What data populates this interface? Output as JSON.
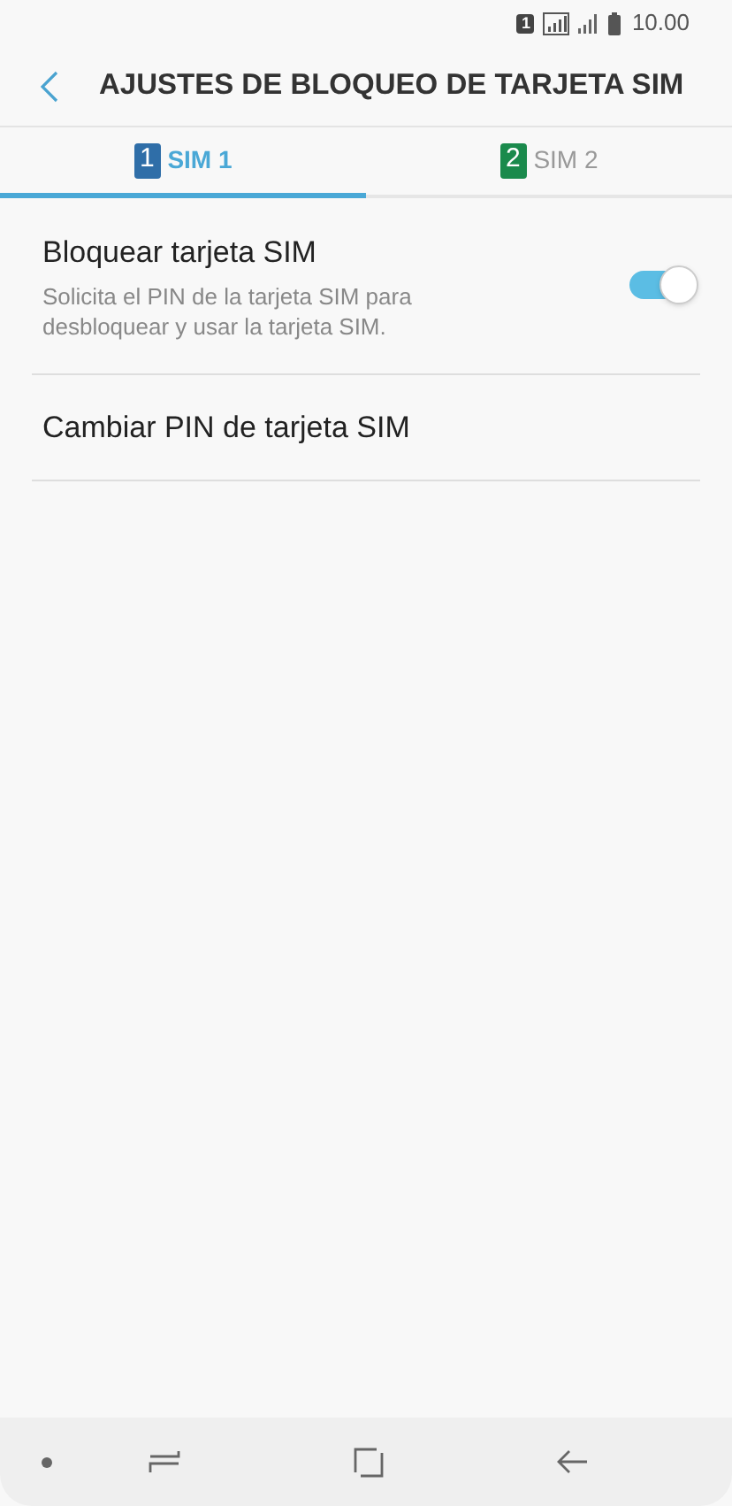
{
  "status_bar": {
    "sim_badge": "1",
    "time": "10.00"
  },
  "header": {
    "title": "AJUSTES DE BLOQUEO DE TARJETA SIM"
  },
  "tabs": [
    {
      "badge": "1",
      "label": "SIM 1",
      "color": "#2f6ea8",
      "selected": true
    },
    {
      "badge": "2",
      "label": "SIM 2",
      "color": "#1a8a4c",
      "selected": false
    }
  ],
  "settings": [
    {
      "kind": "toggle",
      "title": "Bloquear tarjeta SIM",
      "summary": "Solicita el PIN de la tarjeta SIM para desbloquear y usar la tarjeta SIM.",
      "on": true
    },
    {
      "kind": "plain",
      "title": "Cambiar PIN de tarjeta SIM"
    }
  ]
}
